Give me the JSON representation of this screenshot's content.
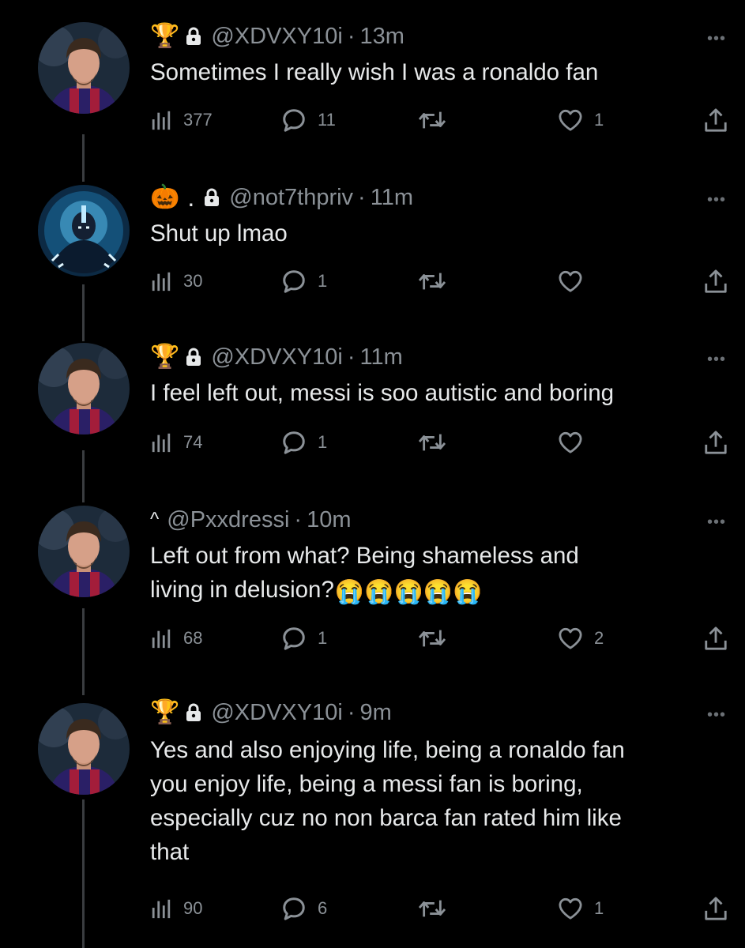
{
  "tweets": [
    {
      "badge": "🏆",
      "locked": true,
      "handle": "@XDVXY10i",
      "time": "13m",
      "text": "Sometimes I really wish I was a ronaldo fan",
      "views": "377",
      "replies": "11",
      "retweets": "",
      "likes": "1"
    },
    {
      "badge": "🎃",
      "badge_suffix": ".",
      "locked": true,
      "handle": "@not7thpriv",
      "time": "11m",
      "text": "Shut up lmao",
      "views": "30",
      "replies": "1",
      "retweets": "",
      "likes": ""
    },
    {
      "badge": "🏆",
      "locked": true,
      "handle": "@XDVXY10i",
      "time": "11m",
      "text": "I feel left out, messi is soo autistic and boring",
      "views": "74",
      "replies": "1",
      "retweets": "",
      "likes": ""
    },
    {
      "badge": "^",
      "locked": false,
      "handle": "@Pxxdressi",
      "time": "10m",
      "text": "Left out from what? Being shameless and\nliving in delusion?",
      "emojis": "😭😭😭😭😭",
      "views": "68",
      "replies": "1",
      "retweets": "",
      "likes": "2"
    },
    {
      "badge": "🏆",
      "locked": true,
      "handle": "@XDVXY10i",
      "time": "9m",
      "text": "Yes and also enjoying life, being a ronaldo fan\nyou enjoy life, being a messi fan is boring,\nespecially cuz no non barca fan rated him like\nthat",
      "views": "90",
      "replies": "6",
      "retweets": "",
      "likes": "1"
    }
  ],
  "separator": "·",
  "more_icon": "•••",
  "icons": [
    "views-icon",
    "reply-icon",
    "retweet-icon",
    "like-icon",
    "share-icon",
    "lock-icon",
    "more-icon"
  ],
  "colors": {
    "background": "#000000",
    "text": "#e7e9ea",
    "muted": "#8b9197",
    "thread_line": "#3a3d40"
  }
}
